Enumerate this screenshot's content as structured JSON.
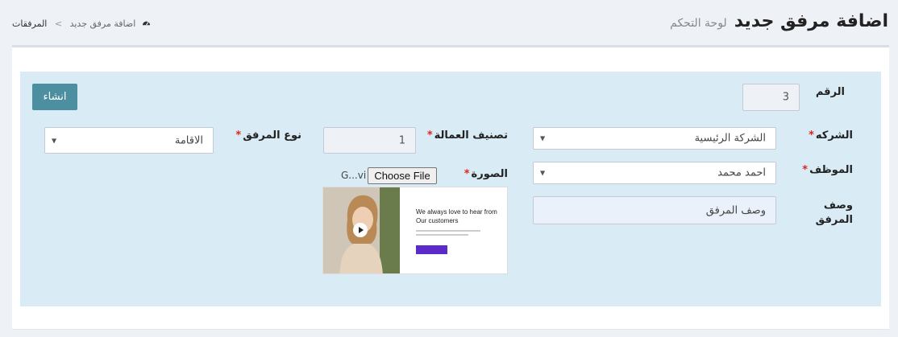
{
  "header": {
    "title": "اضافة مرفق جديد",
    "subtitle": "لوحة التحكم"
  },
  "breadcrumb": {
    "home": "المرفقات",
    "separator": ">",
    "current": "اضافة مرفق جديد"
  },
  "form": {
    "create_button": "انشاء",
    "number": {
      "label": "الرقم",
      "value": "3"
    },
    "company": {
      "label": "الشركه",
      "value": "الشركة الرئيسية"
    },
    "labor_class": {
      "label": "تصنيف العمالة",
      "value": "1"
    },
    "attachment_type": {
      "label": "نوع المرفق",
      "value": "الاقامة"
    },
    "employee": {
      "label": "الموظف",
      "value": "احمد محمد"
    },
    "image": {
      "label": "الصورة",
      "button": "Choose File",
      "filename": "G...vi"
    },
    "description": {
      "label": "وصف المرفق",
      "value": "وصف المرفق"
    },
    "required_mark": "*"
  },
  "preview": {
    "headline_line1": "We always love to hear from",
    "headline_line2": "Our customers"
  },
  "colors": {
    "accent": "#4b8fa1",
    "form_bg": "#d9ecf5",
    "required": "#e02222"
  }
}
